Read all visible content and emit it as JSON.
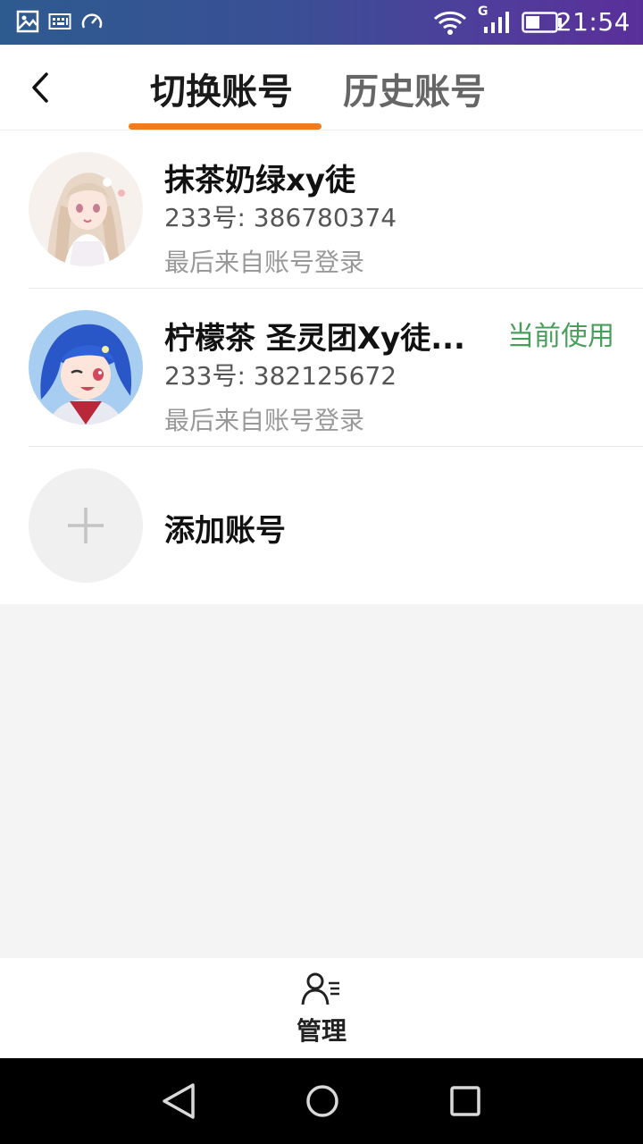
{
  "status_bar": {
    "time": "21:54",
    "network": "G",
    "icons": [
      "image-icon",
      "keyboard-icon",
      "speedometer-icon",
      "wifi-icon",
      "signal-icon",
      "battery-icon"
    ]
  },
  "header": {
    "tabs": [
      {
        "label": "切换账号",
        "active": true
      },
      {
        "label": "历史账号",
        "active": false
      }
    ],
    "accent_color": "#f07c1e"
  },
  "accounts": [
    {
      "name": "抹茶奶绿xy徒",
      "id_text": "233号: 386780374",
      "login_text": "最后来自账号登录",
      "current": false,
      "avatar": "anime-girl-avatar-pale"
    },
    {
      "name": "柠檬茶 圣灵团Xy徒...",
      "id_text": "233号: 382125672",
      "login_text": "最后来自账号登录",
      "current": true,
      "current_label": "当前使用",
      "avatar": "anime-girl-avatar-blue"
    }
  ],
  "add_account": {
    "label": "添加账号"
  },
  "bottom": {
    "manage_label": "管理"
  },
  "colors": {
    "current_badge": "#4a9e5c",
    "tab_indicator": "#f07c1e"
  }
}
